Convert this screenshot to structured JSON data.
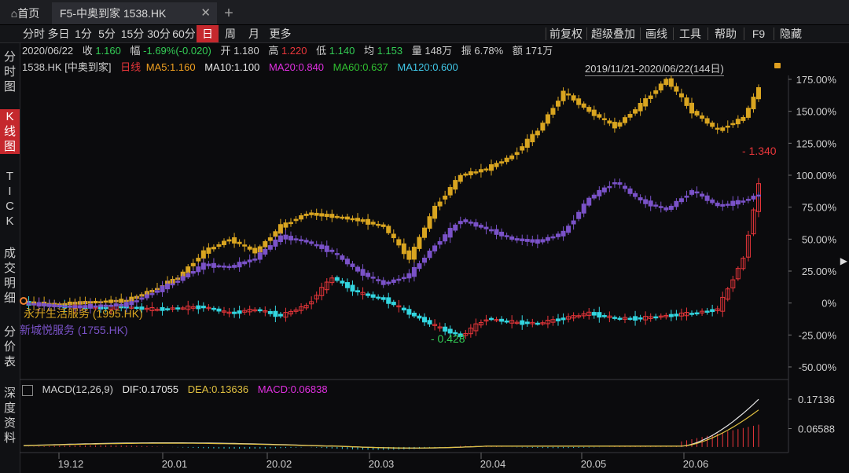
{
  "tabs": {
    "home": "首页",
    "active": "F5-中奥到家 1538.HK",
    "close": "✕",
    "add": "+"
  },
  "toolbar": {
    "left": [
      "分时",
      "多日",
      "1分",
      "5分",
      "15分",
      "30分",
      "60分",
      "日",
      "周",
      "月",
      "更多"
    ],
    "active": "日",
    "right": [
      "前复权",
      "超级叠加",
      "画线",
      "工具",
      "帮助",
      "F9",
      "隐藏"
    ]
  },
  "leftnav": [
    "分时图",
    "K线图",
    "TICK",
    "成交明细",
    "分价表",
    "深度资料"
  ],
  "quote": {
    "date": "2020/06/22",
    "close_label": "收",
    "close": "1.160",
    "change_label": "幅",
    "change": "-1.69%(-0.020)",
    "open_label": "开",
    "open": "1.180",
    "high_label": "高",
    "high": "1.220",
    "low_label": "低",
    "low": "1.140",
    "avg_label": "均",
    "avg": "1.153",
    "vol_label": "量",
    "vol": "148万",
    "amp_label": "振",
    "amp": "6.78%",
    "amount_label": "额",
    "amount": "171万"
  },
  "legend": {
    "symbol": "1538.HK [中奥到家]",
    "period": "日线",
    "ma5": "MA5:1.160",
    "ma10": "MA10:1.100",
    "ma20": "MA20:0.840",
    "ma60": "MA60:0.637",
    "ma120": "MA120:0.600",
    "range": "2019/11/21-2020/06/22(144日)"
  },
  "overlays": {
    "s1": "永升生活服务 (1995.HK)",
    "s2": "新城悦服务 (1755.HK)"
  },
  "annotations": {
    "high": "1.340",
    "low": "0.428"
  },
  "macd": {
    "params": "MACD(12,26,9)",
    "dif": "DIF:0.17055",
    "dea": "DEA:0.13636",
    "macd": "MACD:0.06838",
    "axis_top": "0.17136",
    "axis_mid": "0.06588"
  },
  "colors": {
    "up": "#e8363a",
    "down": "#33d6e0",
    "gold": "#d9a520",
    "purple": "#7a52c8",
    "ma5": "#f0a020",
    "ma10": "#e8e8e8",
    "ma20": "#e030e0",
    "ma60": "#30c030",
    "ma120": "#40c8e8",
    "active": "#c5282d"
  },
  "chart_data": {
    "type": "line",
    "title": "",
    "xlabel": "",
    "ylabel": "",
    "x_ticks": [
      "19.12",
      "20.01",
      "20.02",
      "20.03",
      "20.04",
      "20.05",
      "20.06"
    ],
    "y_ticks": [
      "175.00%",
      "150.00%",
      "125.00%",
      "100.00%",
      "75.00%",
      "50.00%",
      "25.00%",
      "0%",
      "-25.00%",
      "-50.00%"
    ],
    "ylim": [
      -50,
      175
    ],
    "x": [
      0,
      5,
      10,
      15,
      20,
      25,
      30,
      35,
      40,
      45,
      50,
      55,
      60,
      65,
      70,
      75,
      80,
      85,
      90,
      95,
      100,
      105,
      110,
      115,
      120,
      125,
      130,
      135,
      140,
      143
    ],
    "series": [
      {
        "name": "1538.HK",
        "values": [
          0,
          -2,
          -3,
          -4,
          -3,
          -5,
          -4,
          -3,
          -8,
          -5,
          -10,
          -2,
          20,
          8,
          3,
          -8,
          -18,
          -26,
          -12,
          -15,
          -16,
          -12,
          -8,
          -12,
          -12,
          -10,
          -8,
          -5,
          35,
          92
        ]
      },
      {
        "name": "永升生活服务 (1995.HK)",
        "values": [
          0,
          -1,
          0,
          1,
          2,
          10,
          20,
          40,
          50,
          40,
          60,
          70,
          68,
          65,
          60,
          35,
          75,
          100,
          105,
          115,
          135,
          165,
          150,
          138,
          155,
          175,
          150,
          135,
          145,
          168
        ]
      },
      {
        "name": "新城悦服务 (1755.HK)",
        "values": [
          0,
          -2,
          -3,
          -2,
          -1,
          8,
          18,
          30,
          28,
          35,
          52,
          48,
          40,
          25,
          15,
          22,
          45,
          65,
          58,
          50,
          48,
          55,
          82,
          95,
          80,
          73,
          88,
          76,
          80,
          85
        ]
      }
    ],
    "grid": false,
    "legend": "left"
  }
}
